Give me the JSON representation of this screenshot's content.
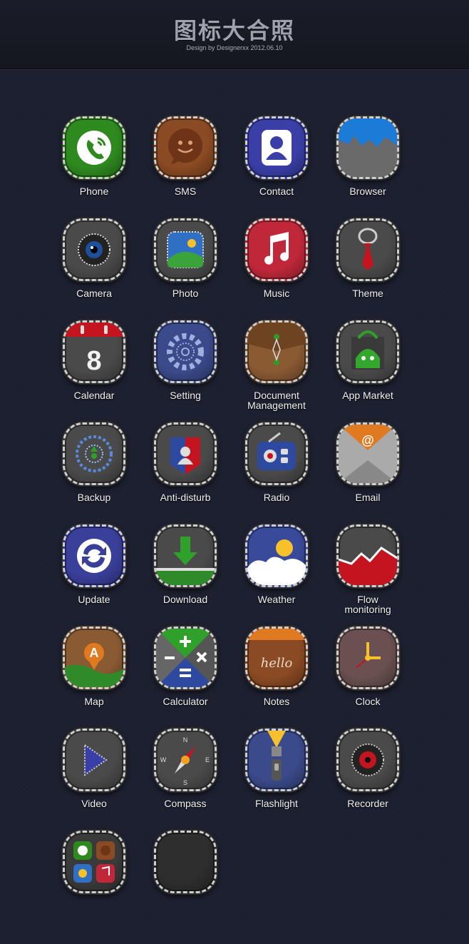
{
  "header": {
    "title": "图标大合照",
    "subtitle": "Design by Designerxx  2012.06.10"
  },
  "icons": [
    {
      "label": "Phone",
      "icon": "phone-icon",
      "color": "#2e8a1f"
    },
    {
      "label": "SMS",
      "icon": "sms-icon",
      "color": "#8a4a23"
    },
    {
      "label": "Contact",
      "icon": "contact-icon",
      "color": "#3a3fa8"
    },
    {
      "label": "Browser",
      "icon": "browser-icon",
      "color": "#5a5a5a"
    },
    {
      "label": "Camera",
      "icon": "camera-icon",
      "color": "#4a4a4a"
    },
    {
      "label": "Photo",
      "icon": "photo-icon",
      "color": "#4a4a4a"
    },
    {
      "label": "Music",
      "icon": "music-icon",
      "color": "#c0283a"
    },
    {
      "label": "Theme",
      "icon": "theme-icon",
      "color": "#4a4a4a"
    },
    {
      "label": "Calendar",
      "icon": "calendar-icon",
      "color": "#4a4a4a",
      "value": "8"
    },
    {
      "label": "Setting",
      "icon": "setting-icon",
      "color": "#3a4a8a"
    },
    {
      "label": "Document Management",
      "icon": "document-icon",
      "color": "#8a5a33"
    },
    {
      "label": "App Market",
      "icon": "app-market-icon",
      "color": "#4a4a4a"
    },
    {
      "label": "Backup",
      "icon": "backup-icon",
      "color": "#4a4a4a"
    },
    {
      "label": "Anti-disturb",
      "icon": "anti-disturb-icon",
      "color": "#4a4a4a"
    },
    {
      "label": "Radio",
      "icon": "radio-icon",
      "color": "#4a4a4a"
    },
    {
      "label": "Email",
      "icon": "email-icon",
      "color": "#5a5a5a",
      "value": "@"
    },
    {
      "label": "Update",
      "icon": "update-icon",
      "color": "#3a3f9a"
    },
    {
      "label": "Download",
      "icon": "download-icon",
      "color": "#4a4a4a"
    },
    {
      "label": "Weather",
      "icon": "weather-icon",
      "color": "#3a4a9a"
    },
    {
      "label": "Flow monitoring",
      "icon": "flow-monitoring-icon",
      "color": "#4a4a4a"
    },
    {
      "label": "Map",
      "icon": "map-icon",
      "color": "#8a5a33",
      "value": "A"
    },
    {
      "label": "Calculator",
      "icon": "calculator-icon",
      "color": "#4a4a4a"
    },
    {
      "label": "Notes",
      "icon": "notes-icon",
      "color": "#8a4a23",
      "value": "hello"
    },
    {
      "label": "Clock",
      "icon": "clock-icon",
      "color": "#6a5050"
    },
    {
      "label": "Video",
      "icon": "video-icon",
      "color": "#4a4a4a"
    },
    {
      "label": "Compass",
      "icon": "compass-icon",
      "color": "#4a4a4a"
    },
    {
      "label": "Flashlight",
      "icon": "flashlight-icon",
      "color": "#3a4a8a"
    },
    {
      "label": "Recorder",
      "icon": "recorder-icon",
      "color": "#4a4a4a"
    },
    {
      "label": "",
      "icon": "folder-icon",
      "color": "#3a3a3a"
    },
    {
      "label": "",
      "icon": "blank-icon",
      "color": "#2e2e2e"
    }
  ]
}
